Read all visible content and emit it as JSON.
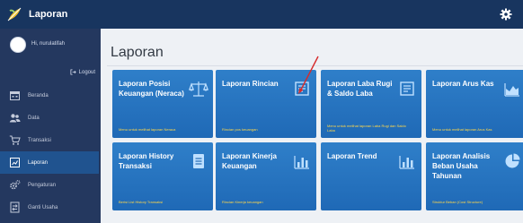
{
  "header": {
    "app_title": "Laporan"
  },
  "sidebar": {
    "greeting": "Hi, nurulatifah",
    "logout_label": "Logout",
    "items": [
      {
        "label": "Beranda",
        "icon": "calendar-icon"
      },
      {
        "label": "Data",
        "icon": "people-icon"
      },
      {
        "label": "Transaksi",
        "icon": "cart-icon"
      },
      {
        "label": "Laporan",
        "icon": "report-icon",
        "active": true
      },
      {
        "label": "Pengaturan",
        "icon": "gears-icon"
      },
      {
        "label": "Ganti Usaha",
        "icon": "swap-icon"
      }
    ]
  },
  "main": {
    "title": "Laporan",
    "tiles": [
      {
        "title": "Laporan Posisi Keuangan (Neraca)",
        "desc": "Menu untuk melihat laporan Neraca",
        "icon": "scale-icon"
      },
      {
        "title": "Laporan Rincian",
        "desc": "Rincian pos keuangan",
        "icon": "document-icon"
      },
      {
        "title": "Laporan Laba Rugi & Saldo Laba",
        "desc": "Menu untuk melihat laporan Laba Rugi dan Saldo Laba",
        "icon": "document-icon"
      },
      {
        "title": "Laporan Arus Kas",
        "desc": "Menu untuk melihat laporan Arus Kas",
        "icon": "area-chart-icon"
      },
      {
        "title": "Laporan History Transaksi",
        "desc": "Berisi List History Transaksi",
        "icon": "document-list-icon"
      },
      {
        "title": "Laporan Kinerja Keuangan",
        "desc": "Rincian Kinerja keuangan",
        "icon": "bar-chart-icon"
      },
      {
        "title": "Laporan Trend",
        "desc": "",
        "icon": "bar-chart-icon"
      },
      {
        "title": "Laporan Analisis Beban Usaha Tahunan",
        "desc": "Struktur Beban (Cost Structure)",
        "icon": "pie-chart-icon"
      }
    ]
  },
  "colors": {
    "topbar": "#18355f",
    "sidebar": "#24385f",
    "active_item": "#20538f",
    "tile": "#2a77c2",
    "tile_desc": "#ffd74a",
    "annotation": "#d62b2b"
  }
}
